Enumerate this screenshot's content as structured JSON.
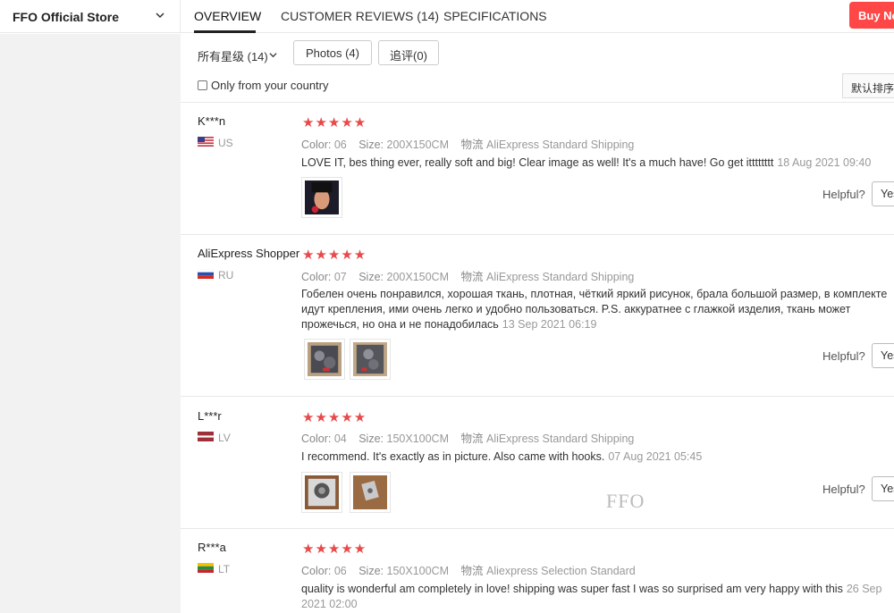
{
  "header": {
    "store_name": "FFO Official Store",
    "tabs": [
      {
        "label": "OVERVIEW"
      },
      {
        "label": "CUSTOMER REVIEWS (14)"
      },
      {
        "label": "SPECIFICATIONS"
      }
    ],
    "buy_label": "Buy No"
  },
  "filters": {
    "all_stars": "所有星级 (14)",
    "photos": "Photos (4)",
    "additional": "追评(0)",
    "country_only": "Only from your country",
    "sort": "默认排序"
  },
  "labels": {
    "color": "Color:",
    "size": "Size:",
    "shipping": "物流",
    "helpful": "Helpful?",
    "yes": "Yes"
  },
  "reviews": [
    {
      "name": "K***n",
      "country": "US",
      "stars": "★★★★★",
      "color": "06",
      "size": "200X150CM",
      "shipping": "AliExpress Standard Shipping",
      "text": "LOVE IT, bes thing ever, really soft and big! Clear image as well! It's a much have! Go get itttttttt",
      "date": "18 Aug 2021 09:40"
    },
    {
      "name": "AliExpress Shopper",
      "country": "RU",
      "stars": "★★★★★",
      "color": "07",
      "size": "200X150CM",
      "shipping": "AliExpress Standard Shipping",
      "text": "Гобелен очень понравился, хорошая ткань, плотная, чёткий яркий рисунок, брала большой размер, в комплекте идут крепления, ими очень легко и удобно пользоваться. P.S. аккуратнее с глажкой изделия, ткань может прожечься, но она и не понадобилась",
      "date": "13 Sep 2021 06:19"
    },
    {
      "name": "L***r",
      "country": "LV",
      "stars": "★★★★★",
      "color": "04",
      "size": "150X100CM",
      "shipping": "AliExpress Standard Shipping",
      "text": "I recommend. It's exactly as in picture. Also came with hooks.",
      "date": "07 Aug 2021 05:45"
    },
    {
      "name": "R***a",
      "country": "LT",
      "stars": "★★★★★",
      "color": "06",
      "size": "150X100CM",
      "shipping": "Aliexpress Selection Standard",
      "text": "quality is wonderful am completely in love! shipping was super fast I was so surprised am very happy with this",
      "date": "26 Sep 2021 02:00"
    }
  ],
  "watermark": "FFO",
  "colors": {
    "accent": "#ff4747",
    "stars": "#e74a4a"
  }
}
